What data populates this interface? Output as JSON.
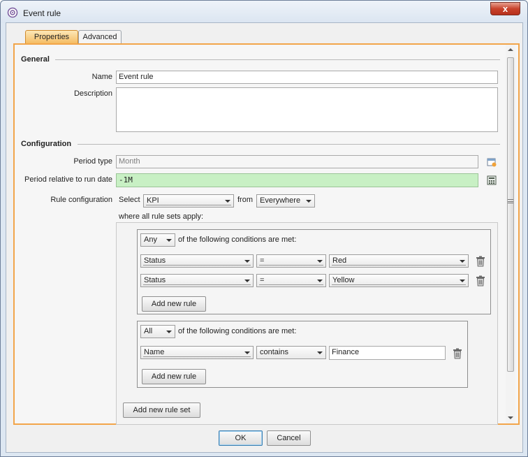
{
  "window": {
    "title": "Event rule",
    "close_label": "x"
  },
  "tabs": [
    {
      "label": "Properties",
      "active": true
    },
    {
      "label": "Advanced",
      "active": false
    }
  ],
  "general": {
    "section_label": "General",
    "name_label": "Name",
    "name_value": "Event rule",
    "description_label": "Description",
    "description_value": ""
  },
  "configuration": {
    "section_label": "Configuration",
    "period_type_label": "Period type",
    "period_type_value": "Month",
    "period_relative_label": "Period relative to run date",
    "period_relative_value": "-1M",
    "rule_config_label": "Rule configuration",
    "select_label": "Select",
    "select_value": "KPI",
    "from_label": "from",
    "from_value": "Everywhere",
    "where_label": "where all rule sets apply:"
  },
  "rule_sets": [
    {
      "quantifier": "Any",
      "condition_text": "of the following conditions are met:",
      "rules": [
        {
          "field": "Status",
          "operator": "=",
          "value": "Red"
        },
        {
          "field": "Status",
          "operator": "=",
          "value": "Yellow"
        }
      ],
      "add_rule_label": "Add new rule"
    },
    {
      "quantifier": "All",
      "condition_text": "of the following conditions are met:",
      "rules": [
        {
          "field": "Name",
          "operator": "contains",
          "value": "Finance"
        }
      ],
      "add_rule_label": "Add new rule"
    }
  ],
  "add_rule_set_label": "Add new rule set",
  "footer": {
    "ok_label": "OK",
    "cancel_label": "Cancel"
  },
  "colors": {
    "active_tab": "#f4b85b",
    "panel_border": "#f2a54a",
    "highlight_field": "#c8f0c4",
    "close_button": "#c8432c"
  }
}
